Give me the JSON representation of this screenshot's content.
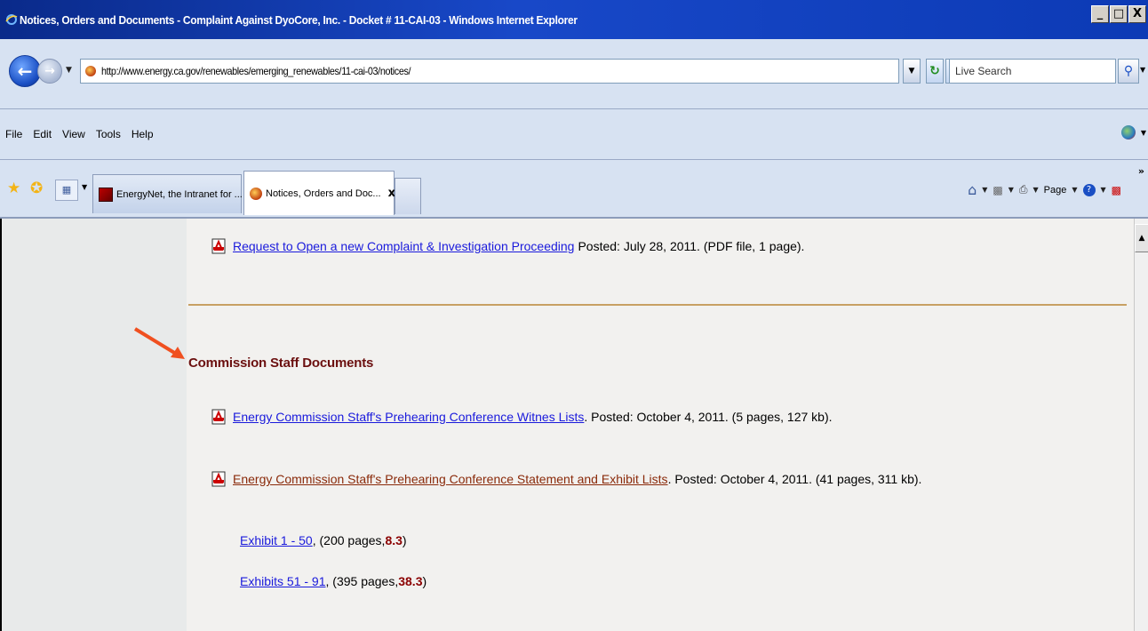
{
  "window": {
    "title": "Notices, Orders and Documents - Complaint Against DyoCore, Inc. - Docket # 11-CAI-03 - Windows Internet Explorer",
    "buttons": [
      "_",
      "□",
      "X"
    ]
  },
  "address_bar": {
    "url": "http://www.energy.ca.gov/renewables/emerging_renewables/11-cai-03/notices/",
    "search_placeholder": "Live Search"
  },
  "menu": {
    "items": [
      "File",
      "Edit",
      "View",
      "Tools",
      "Help"
    ]
  },
  "tabs": [
    {
      "label": "EnergyNet, the Intranet for ...",
      "active": false
    },
    {
      "label": "Notices, Orders and Doc...",
      "active": true
    }
  ],
  "command_bar": {
    "page_label": "Page"
  },
  "content": {
    "top_doc": {
      "link": "Request to Open a new Complaint & Investigation Proceeding",
      "rest": "Posted: July 28, 2011. (PDF file, 1 page)."
    },
    "section_heading": "Commission Staff Documents",
    "docs": [
      {
        "link": "Energy Commission Staff's Prehearing Conference Witnes Lists",
        "rest": ". Posted: October 4, 2011. (5 pages, 127 kb)."
      },
      {
        "link": "Energy Commission Staff's Prehearing Conference Statement and Exhibit Lists",
        "rest": ". Posted: October 4, 2011. (41 pages, 311 kb)."
      }
    ],
    "exhibits": [
      {
        "link": "Exhibit 1 - 50",
        "pages": ", (200 pages, ",
        "size": "8.3",
        "close": ")"
      },
      {
        "link": "Exhibits 51 - 91",
        "pages": ", (395 pages, ",
        "size": "38.3",
        "close": ")"
      }
    ]
  },
  "colors": {
    "link": "#1a1adc",
    "visited_link": "#8a2a0a",
    "heading": "#6b0f0f",
    "divider": "#c8a063",
    "arrow": "#f05020"
  }
}
